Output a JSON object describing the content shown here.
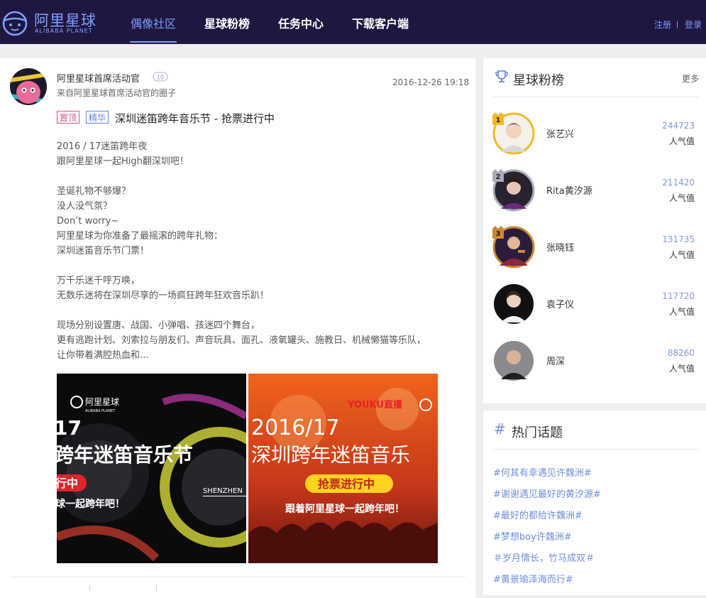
{
  "header": {
    "logo_title": "阿里星球",
    "logo_subtitle": "ALIBABA PLANET",
    "nav": [
      {
        "label": "偶像社区",
        "active": true
      },
      {
        "label": "星球粉榜",
        "active": false
      },
      {
        "label": "任务中心",
        "active": false
      },
      {
        "label": "下载客户端",
        "active": false
      }
    ],
    "register_label": "注册",
    "login_label": "登录",
    "accent_color": "#7e9bff",
    "bg_color": "#1f1740"
  },
  "post": {
    "author_name": "阿里星球首席活动官",
    "author_from": "来自阿里星球首席活动官的圈子",
    "date": "2016-12-26 19:18",
    "tag_top": "置顶",
    "tag_essence": "精华",
    "title": "深圳迷笛跨年音乐节 - 抢票进行中",
    "body_lines": [
      "2016 / 17迷笛跨年夜",
      "跟阿里星球一起High翻深圳吧！",
      "",
      "圣诞礼物不够爆？",
      "没人没气氛？",
      "Don’t worry~",
      "阿里星球为你准备了最摇滚的跨年礼物：",
      "深圳迷笛音乐节门票！",
      "",
      "万千乐迷千呼万唤，",
      "无数乐迷将在深圳尽享的一场疯狂跨年狂欢音乐趴！",
      "",
      "现场分别设置唐、战国、小弹唱、孩迷四个舞台，",
      "更有逃跑计划、刘索拉与朋友们、声音玩具、面孔、液氧罐头、施教日、机械懒猫等乐队，",
      "让你带着满腔热血和..."
    ],
    "image1": {
      "brand": "阿里星球",
      "brand_sub": "ALIBABA PLANET",
      "year": "17",
      "title": "跨年迷笛音乐节",
      "badge": "行中",
      "slogan": "球一起跨年吧！",
      "side_text": "SHENZHEN"
    },
    "image2": {
      "brand": "YOUKU直播",
      "year": "2016/17",
      "title": "深圳跨年迷笛音乐",
      "badge": "抢票进行中",
      "slogan": "跟着阿里星球一起跨年吧！"
    }
  },
  "ranking": {
    "title": "星球粉榜",
    "more_label": "更多",
    "unit_label": "人气值",
    "items": [
      {
        "rank": "1",
        "name": "张艺兴",
        "score": "244723"
      },
      {
        "rank": "2",
        "name": "Rita黄汐源",
        "score": "211420"
      },
      {
        "rank": "3",
        "name": "张晓钰",
        "score": "131735"
      },
      {
        "rank": "",
        "name": "袁子仪",
        "score": "117720"
      },
      {
        "rank": "",
        "name": "周深",
        "score": "88260"
      }
    ]
  },
  "topics": {
    "title": "热门话题",
    "items": [
      "#何其有幸遇见许魏洲#",
      "#谢谢遇见最好的黄汐源#",
      "#最好的都给许魏洲#",
      "#梦想boy许魏洲#",
      "＃岁月情长，竹马成双＃",
      "#黄景瑜泽海而行#"
    ]
  }
}
